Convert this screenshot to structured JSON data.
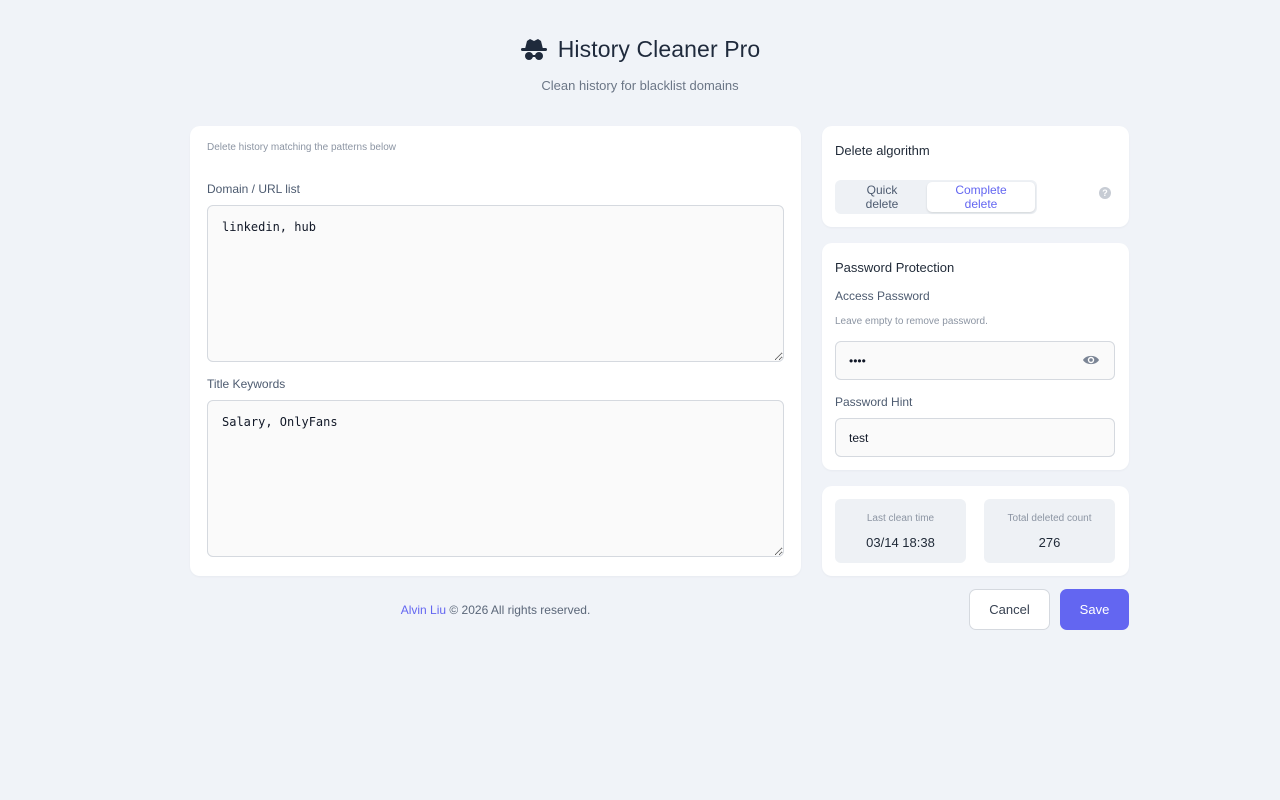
{
  "header": {
    "title": "History Cleaner Pro",
    "subtitle": "Clean history for blacklist domains",
    "logo_icon": "spy-hat-icon"
  },
  "patterns": {
    "hint": "Delete history matching the patterns below",
    "domain_label": "Domain / URL list",
    "domain_value": "linkedin, hub",
    "title_label": "Title Keywords",
    "title_value": "Salary, OnlyFans"
  },
  "algorithm": {
    "title": "Delete algorithm",
    "options": [
      "Quick delete",
      "Complete delete"
    ],
    "selected": "Complete delete",
    "help_icon": "question-icon"
  },
  "password": {
    "title": "Password Protection",
    "access_label": "Access Password",
    "access_hint": "Leave empty to remove password.",
    "access_value": "test",
    "toggle_icon": "eye-icon",
    "hint_label": "Password Hint",
    "hint_value": "test"
  },
  "stats": {
    "last_clean_label": "Last clean time",
    "last_clean_value": "03/14 18:38",
    "total_label": "Total deleted count",
    "total_value": "276"
  },
  "footer": {
    "author": "Alvin Liu",
    "rest": " © 2026 All rights reserved."
  },
  "actions": {
    "cancel_label": "Cancel",
    "save_label": "Save"
  },
  "colors": {
    "accent": "#6366f1",
    "background": "#f0f3f8"
  }
}
